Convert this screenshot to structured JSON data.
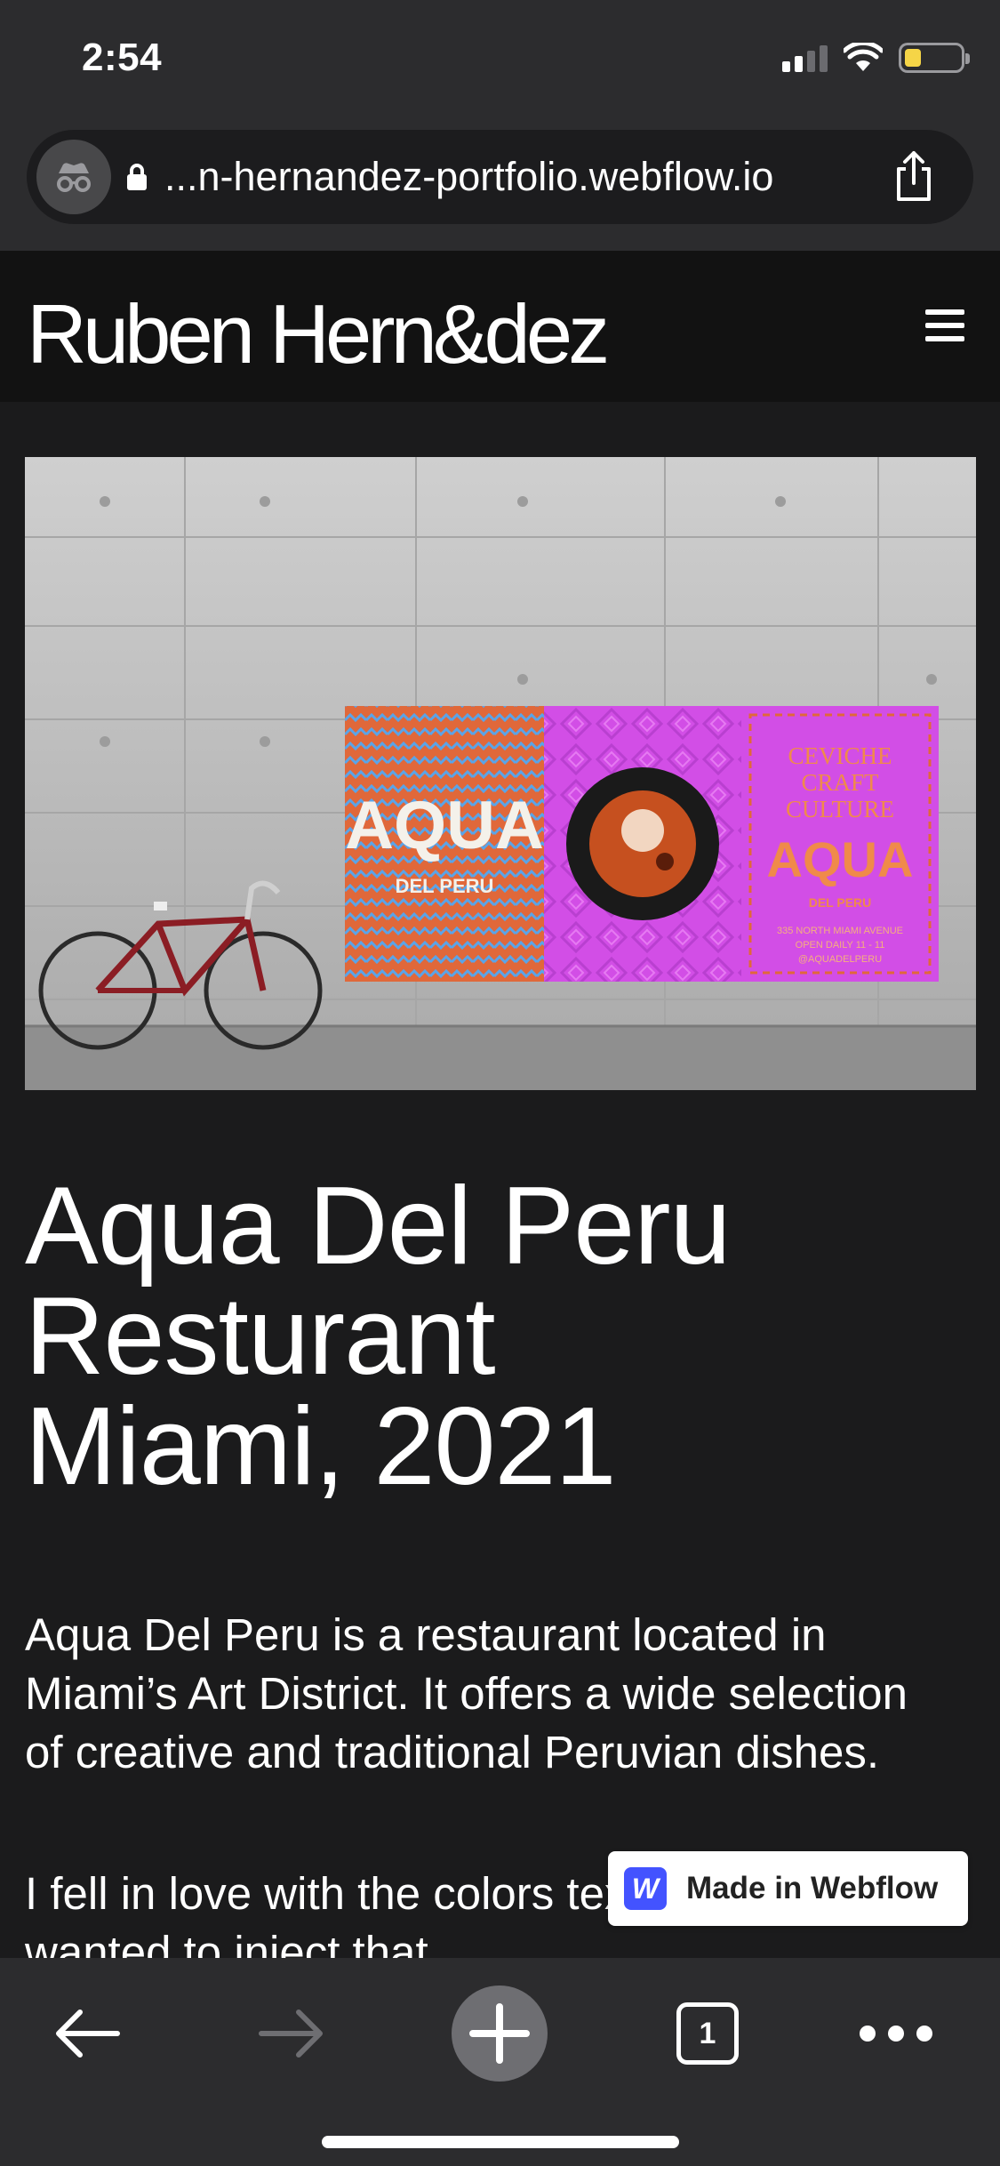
{
  "status_bar": {
    "time": "2:54"
  },
  "browser": {
    "url": "...n-hernandez-portfolio.webflow.io",
    "tab_count": "1"
  },
  "site": {
    "logo": "Ruben Hern&dez"
  },
  "hero_poster": {
    "brand": "AQUA",
    "brand_sub": "DEL PERU",
    "tagline": [
      "CEVICHE",
      "CRAFT",
      "CULTURE"
    ],
    "address": "335 NORTH MIAMI AVENUE",
    "hours": "OPEN DAILY 11 - 11",
    "handle": "@AQUADELPERU"
  },
  "project": {
    "title_lines": [
      "Aqua Del Peru",
      "Resturant",
      "Miami, 2021"
    ],
    "para1": "Aqua Del Peru is a restaurant located in Miami’s Art District. It offers a wide selection of creative and traditional Peruvian dishes.",
    "para2": "I fell in love with the colors textile designs. I wanted to inject that"
  },
  "badge": {
    "label": "Made in Webflow",
    "logo_letter": "W"
  },
  "colors": {
    "page_bg": "#1b1b1c",
    "chrome_bg": "#2c2c2e",
    "poster_orange": "#e0683a",
    "poster_magenta": "#d24ee6",
    "webflow_blue": "#4353ff"
  }
}
